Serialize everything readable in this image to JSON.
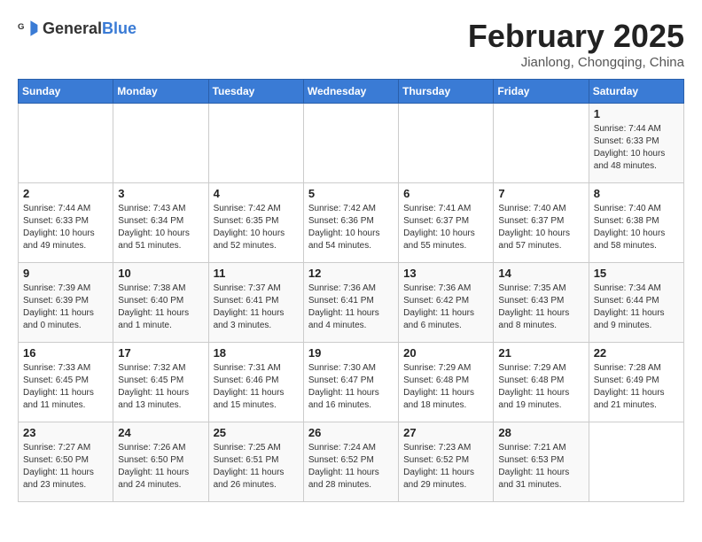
{
  "logo": {
    "general": "General",
    "blue": "Blue"
  },
  "title": "February 2025",
  "subtitle": "Jianlong, Chongqing, China",
  "weekdays": [
    "Sunday",
    "Monday",
    "Tuesday",
    "Wednesday",
    "Thursday",
    "Friday",
    "Saturday"
  ],
  "weeks": [
    [
      {
        "day": "",
        "text": ""
      },
      {
        "day": "",
        "text": ""
      },
      {
        "day": "",
        "text": ""
      },
      {
        "day": "",
        "text": ""
      },
      {
        "day": "",
        "text": ""
      },
      {
        "day": "",
        "text": ""
      },
      {
        "day": "1",
        "text": "Sunrise: 7:44 AM\nSunset: 6:33 PM\nDaylight: 10 hours and 48 minutes."
      }
    ],
    [
      {
        "day": "2",
        "text": "Sunrise: 7:44 AM\nSunset: 6:33 PM\nDaylight: 10 hours and 49 minutes."
      },
      {
        "day": "3",
        "text": "Sunrise: 7:43 AM\nSunset: 6:34 PM\nDaylight: 10 hours and 51 minutes."
      },
      {
        "day": "4",
        "text": "Sunrise: 7:42 AM\nSunset: 6:35 PM\nDaylight: 10 hours and 52 minutes."
      },
      {
        "day": "5",
        "text": "Sunrise: 7:42 AM\nSunset: 6:36 PM\nDaylight: 10 hours and 54 minutes."
      },
      {
        "day": "6",
        "text": "Sunrise: 7:41 AM\nSunset: 6:37 PM\nDaylight: 10 hours and 55 minutes."
      },
      {
        "day": "7",
        "text": "Sunrise: 7:40 AM\nSunset: 6:37 PM\nDaylight: 10 hours and 57 minutes."
      },
      {
        "day": "8",
        "text": "Sunrise: 7:40 AM\nSunset: 6:38 PM\nDaylight: 10 hours and 58 minutes."
      }
    ],
    [
      {
        "day": "9",
        "text": "Sunrise: 7:39 AM\nSunset: 6:39 PM\nDaylight: 11 hours and 0 minutes."
      },
      {
        "day": "10",
        "text": "Sunrise: 7:38 AM\nSunset: 6:40 PM\nDaylight: 11 hours and 1 minute."
      },
      {
        "day": "11",
        "text": "Sunrise: 7:37 AM\nSunset: 6:41 PM\nDaylight: 11 hours and 3 minutes."
      },
      {
        "day": "12",
        "text": "Sunrise: 7:36 AM\nSunset: 6:41 PM\nDaylight: 11 hours and 4 minutes."
      },
      {
        "day": "13",
        "text": "Sunrise: 7:36 AM\nSunset: 6:42 PM\nDaylight: 11 hours and 6 minutes."
      },
      {
        "day": "14",
        "text": "Sunrise: 7:35 AM\nSunset: 6:43 PM\nDaylight: 11 hours and 8 minutes."
      },
      {
        "day": "15",
        "text": "Sunrise: 7:34 AM\nSunset: 6:44 PM\nDaylight: 11 hours and 9 minutes."
      }
    ],
    [
      {
        "day": "16",
        "text": "Sunrise: 7:33 AM\nSunset: 6:45 PM\nDaylight: 11 hours and 11 minutes."
      },
      {
        "day": "17",
        "text": "Sunrise: 7:32 AM\nSunset: 6:45 PM\nDaylight: 11 hours and 13 minutes."
      },
      {
        "day": "18",
        "text": "Sunrise: 7:31 AM\nSunset: 6:46 PM\nDaylight: 11 hours and 15 minutes."
      },
      {
        "day": "19",
        "text": "Sunrise: 7:30 AM\nSunset: 6:47 PM\nDaylight: 11 hours and 16 minutes."
      },
      {
        "day": "20",
        "text": "Sunrise: 7:29 AM\nSunset: 6:48 PM\nDaylight: 11 hours and 18 minutes."
      },
      {
        "day": "21",
        "text": "Sunrise: 7:29 AM\nSunset: 6:48 PM\nDaylight: 11 hours and 19 minutes."
      },
      {
        "day": "22",
        "text": "Sunrise: 7:28 AM\nSunset: 6:49 PM\nDaylight: 11 hours and 21 minutes."
      }
    ],
    [
      {
        "day": "23",
        "text": "Sunrise: 7:27 AM\nSunset: 6:50 PM\nDaylight: 11 hours and 23 minutes."
      },
      {
        "day": "24",
        "text": "Sunrise: 7:26 AM\nSunset: 6:50 PM\nDaylight: 11 hours and 24 minutes."
      },
      {
        "day": "25",
        "text": "Sunrise: 7:25 AM\nSunset: 6:51 PM\nDaylight: 11 hours and 26 minutes."
      },
      {
        "day": "26",
        "text": "Sunrise: 7:24 AM\nSunset: 6:52 PM\nDaylight: 11 hours and 28 minutes."
      },
      {
        "day": "27",
        "text": "Sunrise: 7:23 AM\nSunset: 6:52 PM\nDaylight: 11 hours and 29 minutes."
      },
      {
        "day": "28",
        "text": "Sunrise: 7:21 AM\nSunset: 6:53 PM\nDaylight: 11 hours and 31 minutes."
      },
      {
        "day": "",
        "text": ""
      }
    ]
  ]
}
